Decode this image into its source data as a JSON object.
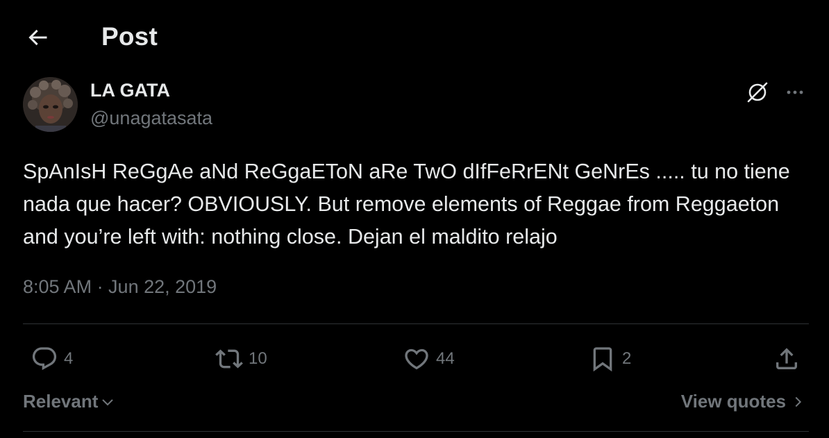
{
  "header": {
    "title": "Post",
    "back_icon": "arrow-left-icon"
  },
  "author": {
    "display_name": "LA GATA",
    "handle": "@unagatasata",
    "avatar": "user-avatar"
  },
  "post": {
    "text": "SpAnIsH ReGgAe aNd ReGgaEToN aRe TwO dIfFeRrENt GeNrEs ..... tu no tiene nada que hacer? OBVIOUSLY. But remove elements of Reggae from Reggaeton and you’re left with: nothing close. Dejan el maldito relajo",
    "timestamp": "8:05 AM · Jun 22, 2019"
  },
  "actions": {
    "reply": {
      "icon": "reply-icon",
      "count": "4"
    },
    "retweet": {
      "icon": "retweet-icon",
      "count": "10"
    },
    "like": {
      "icon": "heart-icon",
      "count": "44"
    },
    "bookmark": {
      "icon": "bookmark-icon",
      "count": "2"
    },
    "share": {
      "icon": "share-icon"
    }
  },
  "footer": {
    "sort_label": "Relevant",
    "view_quotes_label": "View quotes"
  },
  "colors": {
    "background": "#000000",
    "text": "#e7e9ea",
    "muted": "#71767b",
    "divider": "#2f3336"
  }
}
